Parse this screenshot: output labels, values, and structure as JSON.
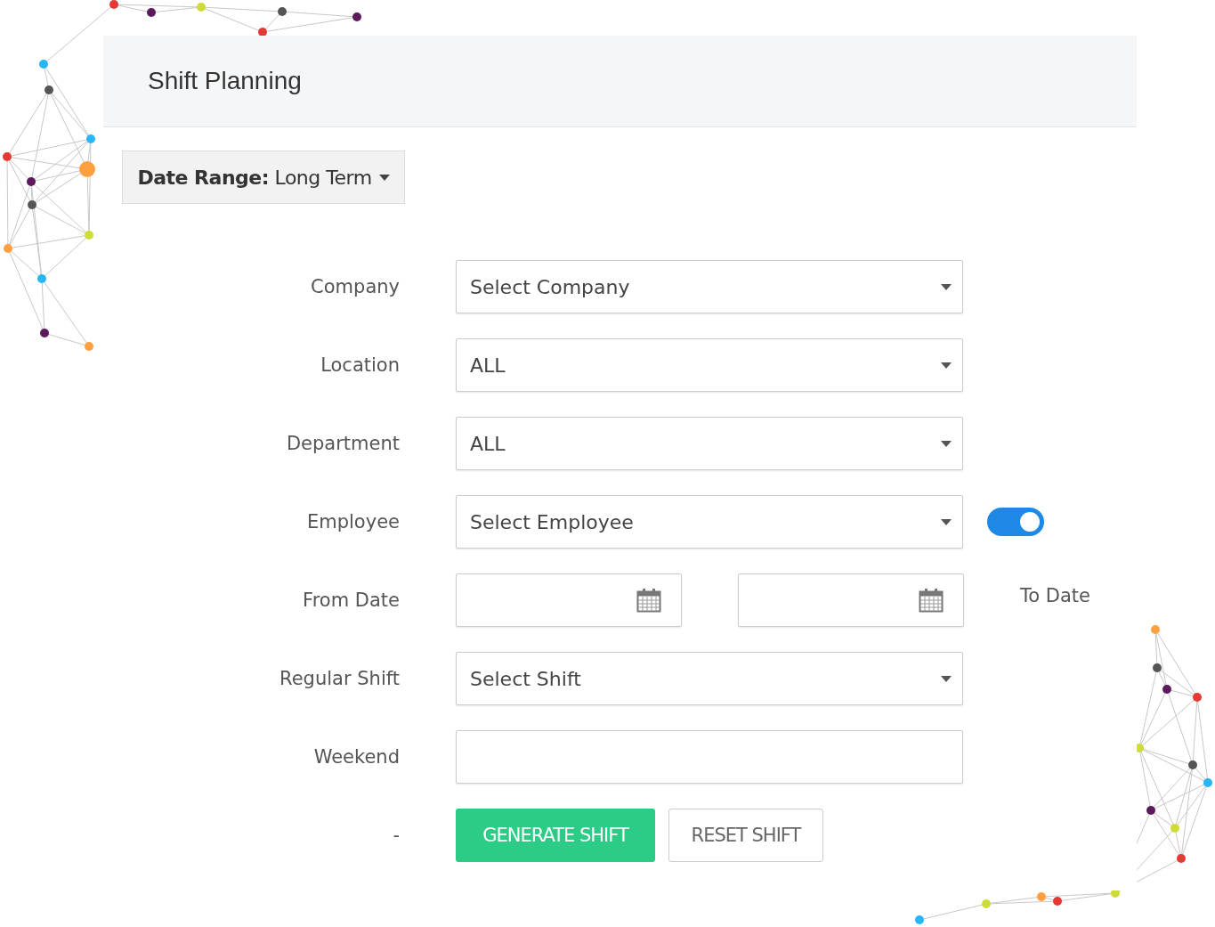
{
  "header": {
    "title": "Shift Planning"
  },
  "date_range": {
    "label": "**Date Range:** Long Term"
  },
  "fields": [
    {
      "kind": "select",
      "label": "Company",
      "value": "Select Company"
    },
    {
      "kind": "select",
      "label": "Location",
      "value": "ALL"
    },
    {
      "kind": "select",
      "label": "Department",
      "value": "ALL"
    },
    {
      "kind": "select",
      "label": "Employee",
      "value": "Select Employee",
      "toggle": {
        "on": true
      }
    },
    {
      "kind": "dates",
      "label": "From Date",
      "side_label": "To Date"
    },
    {
      "kind": "select",
      "label": "Regular Shift",
      "value": "Select Shift"
    },
    {
      "kind": "text",
      "label": "Weekend"
    }
  ],
  "actions": {
    "label": "-",
    "buttons": [
      {
        "kind": "primary",
        "label": "GENERATE SHIFT"
      },
      {
        "kind": "secondary",
        "label": "RESET SHIFT"
      }
    ]
  }
}
